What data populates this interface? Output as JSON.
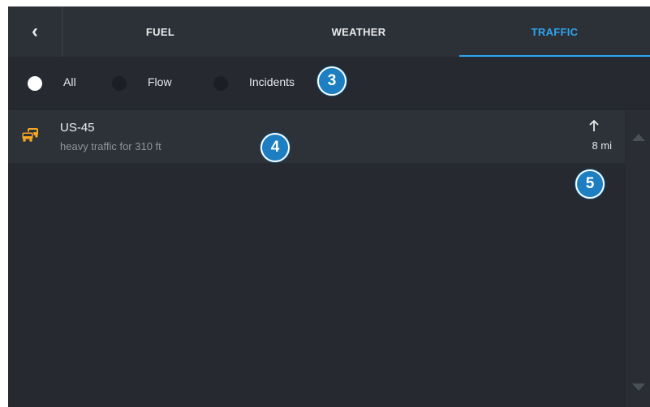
{
  "header": {
    "back_glyph": "‹",
    "tabs": [
      {
        "label": "FUEL",
        "active": false
      },
      {
        "label": "WEATHER",
        "active": false
      },
      {
        "label": "TRAFFIC",
        "active": true
      }
    ]
  },
  "filters": {
    "options": [
      {
        "label": "All",
        "selected": true
      },
      {
        "label": "Flow",
        "selected": false
      },
      {
        "label": "Incidents",
        "selected": false
      }
    ]
  },
  "traffic_list": [
    {
      "icon": "traffic-cars-icon",
      "road": "US-45",
      "description": "heavy traffic for 310 ft",
      "direction_icon": "arrow-up-icon",
      "distance": "8 mi"
    }
  ],
  "callouts": [
    "3",
    "4",
    "5"
  ],
  "colors": {
    "accent": "#2ea4ee",
    "background": "#262a30",
    "traffic_icon": "#f5a623",
    "callout": "#1d7fc2"
  }
}
